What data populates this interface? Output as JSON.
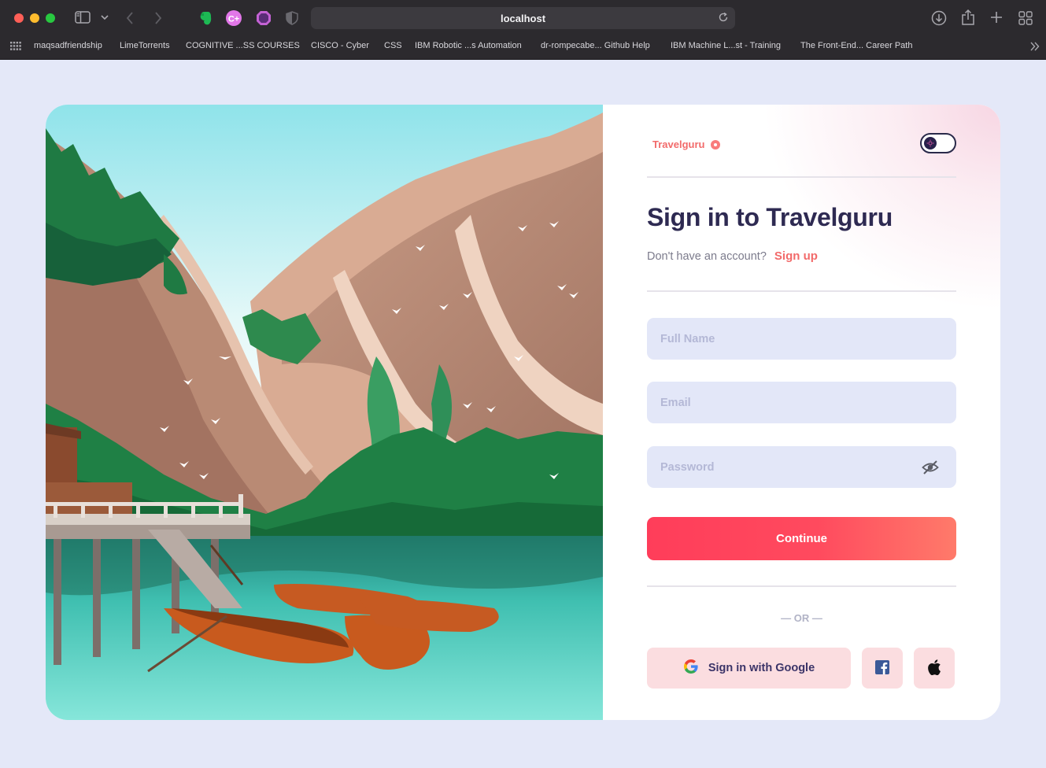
{
  "browser": {
    "url": "localhost",
    "bookmarks": [
      "maqsadfriendship",
      "LimeTorrents",
      "COGNITIVE ...SS COURSES",
      "CISCO - Cyber",
      "CSS",
      "IBM Robotic ...s Automation",
      "dr-rompecabe... Github Help",
      "IBM Machine L...st - Training",
      "The Front-End... Career Path"
    ]
  },
  "brand": {
    "name": "Travelguru"
  },
  "signin": {
    "title": "Sign in to Travelguru",
    "no_account": "Don't have an account?",
    "signup_label": "Sign up",
    "fullname_placeholder": "Full Name",
    "email_placeholder": "Email",
    "password_placeholder": "Password",
    "continue_label": "Continue",
    "or_label": "— OR —",
    "google_label": "Sign in with Google"
  },
  "colors": {
    "accent": "#f26a6a",
    "button_gradient_start": "#ff3d5a",
    "button_gradient_end": "#ff7a6a",
    "field_bg": "#e3e7f8",
    "page_bg": "#e4e8f8",
    "title": "#2e2a52"
  },
  "icons": [
    "evernote-icon",
    "cpp-icon",
    "extension-icon",
    "shield-icon",
    "eye-slash-icon",
    "google-icon",
    "facebook-icon",
    "apple-icon",
    "theme-toggle-icon"
  ]
}
